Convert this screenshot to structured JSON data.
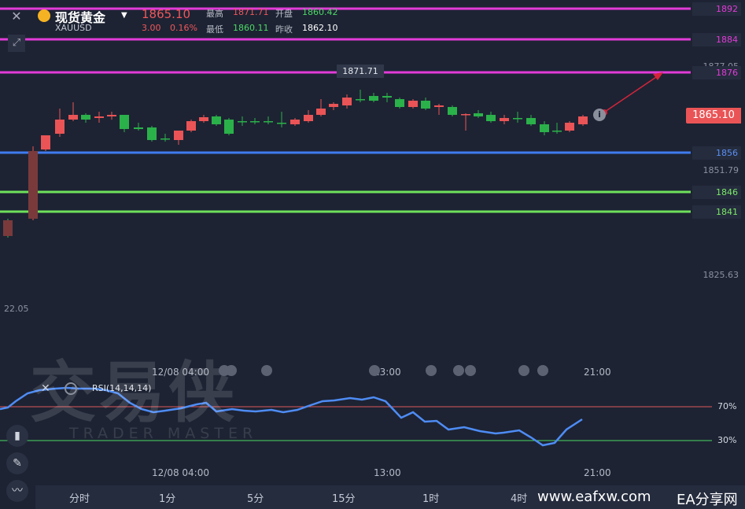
{
  "header": {
    "title": "现货黄金",
    "symbol": "XAUUSD",
    "last_price": "1865.10",
    "change": "3.00",
    "change_pct": "0.16%",
    "high_label": "最高",
    "high": "1871.71",
    "open_label": "开盘",
    "open": "1860.42",
    "low_label": "最低",
    "low": "1860.11",
    "prev_close_label": "昨收",
    "prev_close": "1862.10"
  },
  "price_axis": {
    "ticks": [
      "1877.05",
      "1851.79",
      "1825.63",
      "22.05"
    ],
    "levels": [
      {
        "value": "1892",
        "color": "#e23bd8"
      },
      {
        "value": "1884",
        "color": "#e23bd8"
      },
      {
        "value": "1876",
        "color": "#e23bd8"
      },
      {
        "value": "1856",
        "color": "#3f7bf0"
      },
      {
        "value": "1846",
        "color": "#6ee05b"
      },
      {
        "value": "1841",
        "color": "#6ee05b"
      }
    ],
    "current_price": "1865.10",
    "peak_marker": "1871.71"
  },
  "time_axis": [
    "12/08 04:00",
    "13:00",
    "21:00"
  ],
  "rsi": {
    "label": "RSI(14,14,14)",
    "upper": "70%",
    "lower": "30%"
  },
  "tabs": [
    "分时",
    "1分",
    "5分",
    "15分",
    "1时",
    "4时"
  ],
  "watermark": {
    "brand": "交易侠",
    "sub": "TRADER MASTER"
  },
  "site": {
    "url": "www.eafxw.com",
    "name": "EA分享网"
  },
  "colors": {
    "up": "#ea5456",
    "down": "#2bb14a",
    "magenta": "#e23bd8",
    "blue": "#3f7bf0",
    "green": "#6ee05b",
    "rsi": "#4e8cf5"
  },
  "icons": [
    "close-icon",
    "draw-tool-icon",
    "coin-icon",
    "chevron-down-icon",
    "info-icon",
    "indicator-icon",
    "pen-icon",
    "line-tool-icon"
  ]
}
